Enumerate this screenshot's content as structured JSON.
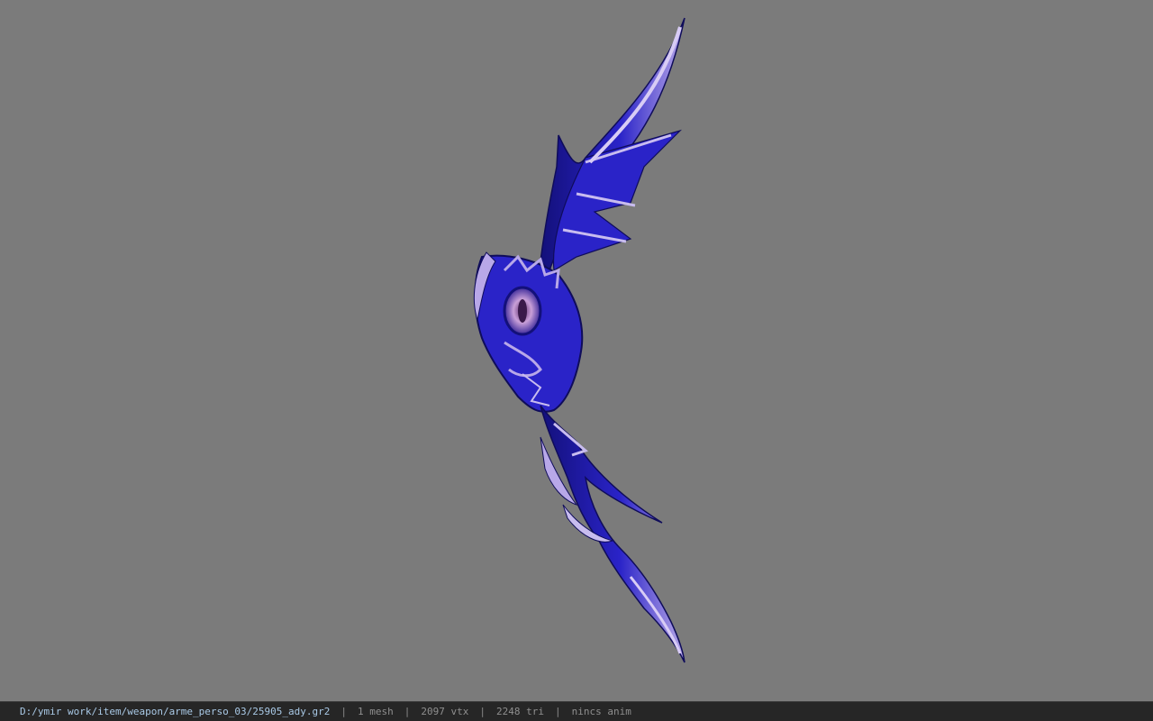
{
  "viewport": {
    "background_color": "#7b7b7b",
    "model_colors": {
      "primary": "#2a23c8",
      "dark": "#13107a",
      "highlight": "#b8a8e8",
      "eye": "#c9a0d8"
    }
  },
  "statusbar": {
    "file_path": "D:/ymir work/item/weapon/arme_perso_03/25905_ady.gr2",
    "mesh_count": "1 mesh",
    "vertex_count": "2097 vtx",
    "triangle_count": "2248 tri",
    "anim_status": "nincs anim",
    "separator": "|"
  }
}
